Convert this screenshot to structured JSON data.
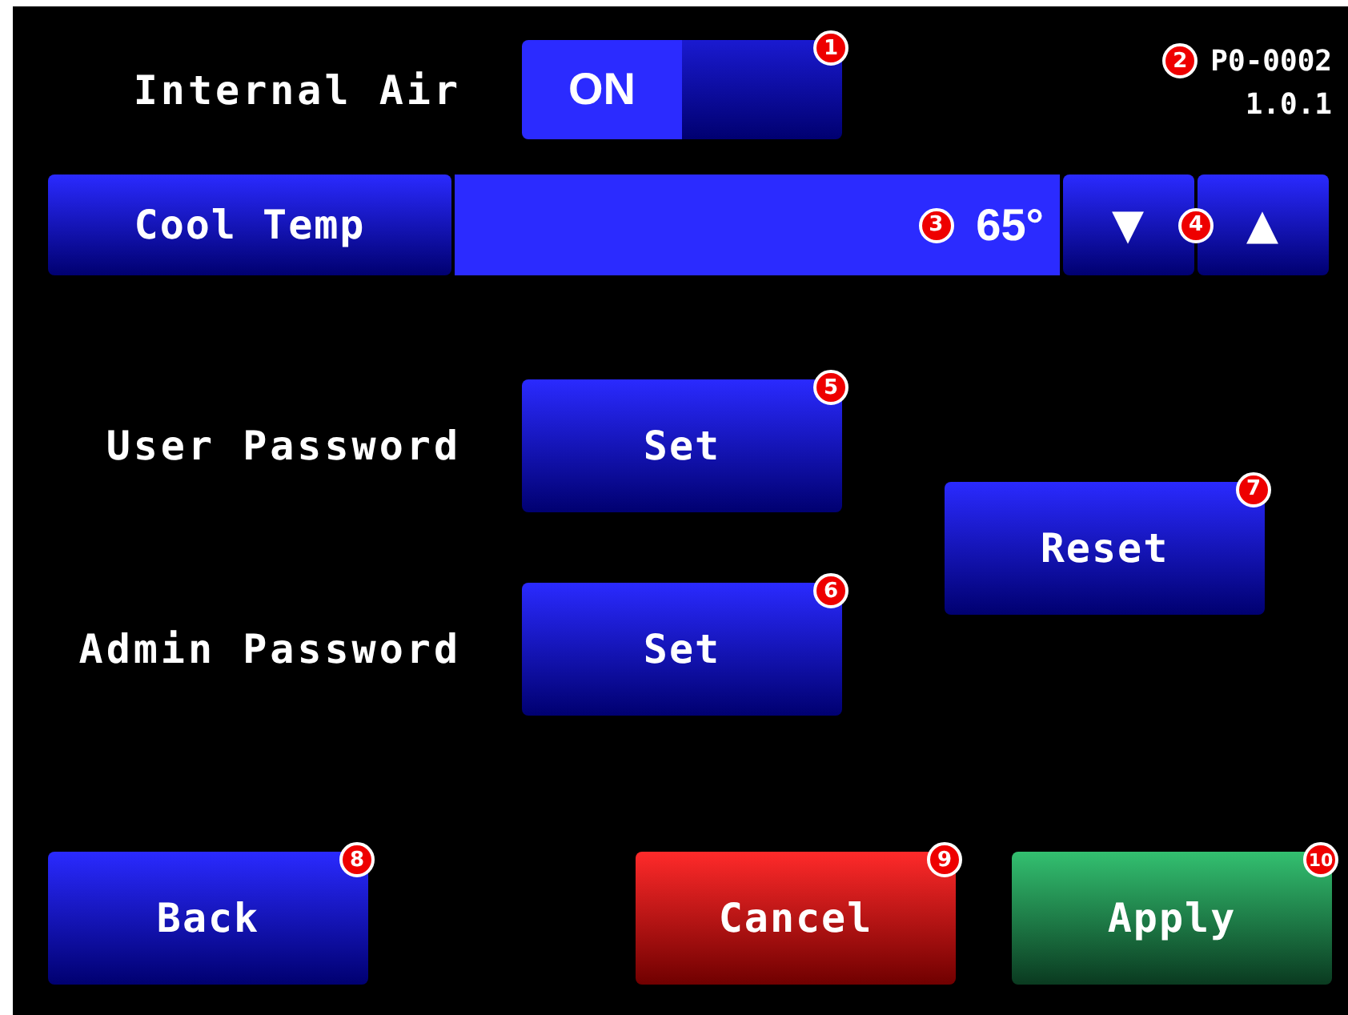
{
  "internal_air": {
    "label": "Internal Air",
    "toggle": {
      "label": "ON",
      "on": true,
      "marker": "1"
    }
  },
  "version": {
    "code": "P0-0002",
    "number": "1.0.1",
    "marker": "2"
  },
  "cool_temp": {
    "label": "Cool Temp",
    "value": "65°",
    "value_marker": "3",
    "down": "▼",
    "up": "▲",
    "step_marker": "4"
  },
  "passwords": [
    {
      "label": "User Password",
      "button": "Set",
      "marker": "5"
    },
    {
      "label": "Admin Password",
      "button": "Set",
      "marker": "6"
    }
  ],
  "reset": {
    "label": "Reset",
    "marker": "7"
  },
  "buttons": [
    {
      "label": "Back",
      "kind": "back",
      "marker": "8"
    },
    {
      "label": "Cancel",
      "kind": "cancel",
      "marker": "9"
    },
    {
      "label": "Apply",
      "kind": "apply",
      "marker": "10"
    }
  ]
}
